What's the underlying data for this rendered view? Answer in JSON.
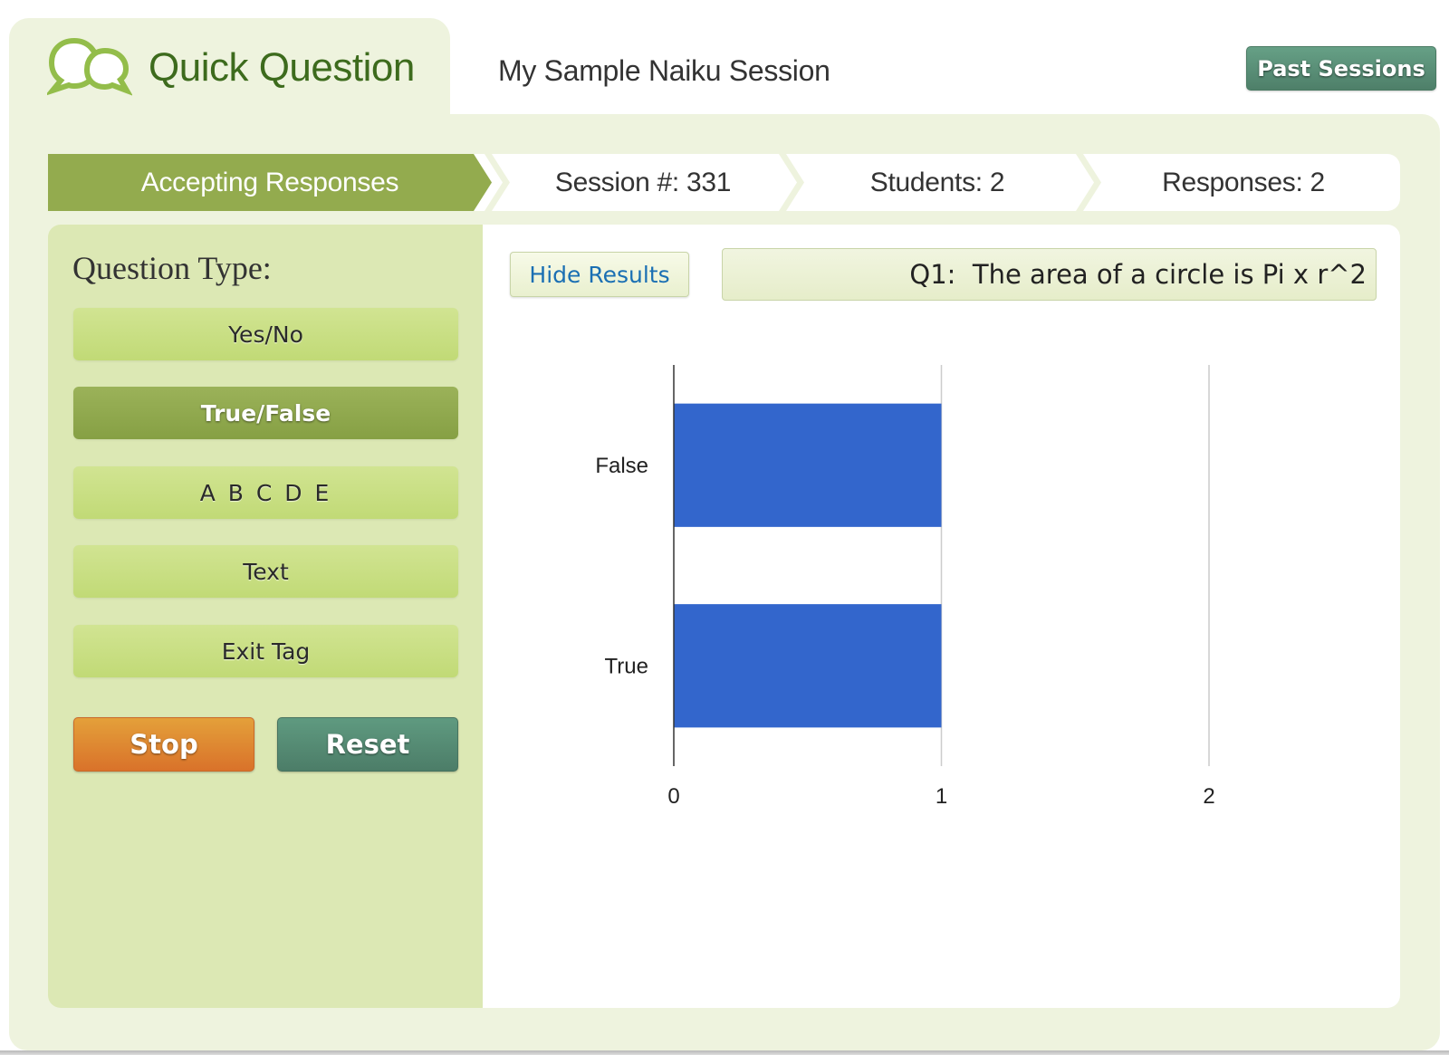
{
  "header": {
    "app_title": "Quick Question",
    "logo_icon": "chat-bubbles-icon",
    "session_name": "My Sample Naiku Session",
    "past_sessions_label": "Past Sessions"
  },
  "status_bar": {
    "state": "Accepting Responses",
    "session": "Session #:  331",
    "students": "Students:  2",
    "responses": "Responses:  2"
  },
  "sidebar": {
    "label": "Question Type:",
    "types": [
      {
        "label": "Yes/No",
        "selected": false
      },
      {
        "label": "True/False",
        "selected": true
      },
      {
        "label": "A B C D E",
        "selected": false
      },
      {
        "label": "Text",
        "selected": false
      },
      {
        "label": "Exit Tag",
        "selected": false
      }
    ],
    "stop_label": "Stop",
    "reset_label": "Reset"
  },
  "content": {
    "hide_results_label": "Hide Results",
    "question_text": "Q1:  The area of a circle is Pi x r^2"
  },
  "colors": {
    "accent_green": "#93ab4e",
    "bar_blue": "#3366cc",
    "stop_orange": "#de8430",
    "reset_teal": "#568a73"
  },
  "chart_data": {
    "type": "bar",
    "orientation": "horizontal",
    "categories": [
      "False",
      "True"
    ],
    "values": [
      1,
      1
    ],
    "title": "",
    "xlabel": "",
    "ylabel": "",
    "xlim": [
      0,
      2
    ],
    "xticks": [
      "0",
      "1",
      "2"
    ],
    "grid": true,
    "legend": "none"
  }
}
